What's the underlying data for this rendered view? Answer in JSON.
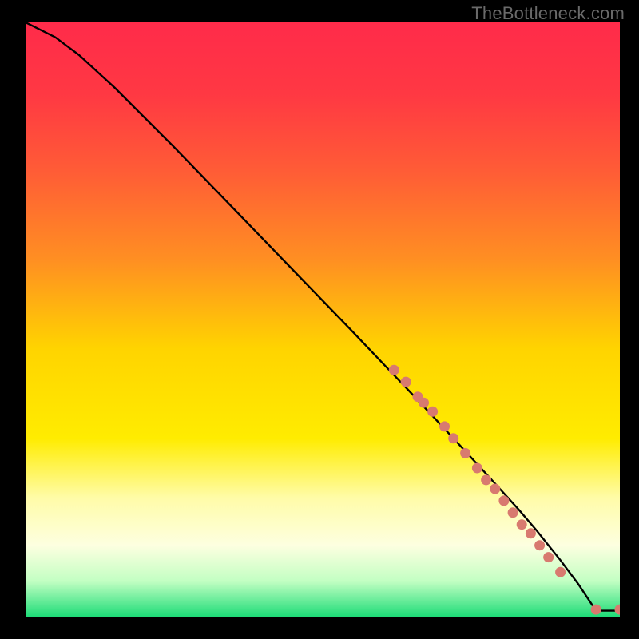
{
  "watermark": "TheBottleneck.com",
  "chart_data": {
    "type": "line",
    "title": "",
    "xlabel": "",
    "ylabel": "",
    "xlim": [
      0,
      100
    ],
    "ylim": [
      0,
      100
    ],
    "grid": false,
    "background_gradient": {
      "stops": [
        {
          "offset": 0,
          "color": "#ff2b4a"
        },
        {
          "offset": 12,
          "color": "#ff3843"
        },
        {
          "offset": 25,
          "color": "#ff5c36"
        },
        {
          "offset": 40,
          "color": "#ff8f22"
        },
        {
          "offset": 55,
          "color": "#ffd400"
        },
        {
          "offset": 70,
          "color": "#ffec00"
        },
        {
          "offset": 80,
          "color": "#fffca8"
        },
        {
          "offset": 88,
          "color": "#fdffe0"
        },
        {
          "offset": 94,
          "color": "#c3ffc3"
        },
        {
          "offset": 100,
          "color": "#1edc78"
        }
      ]
    },
    "series": [
      {
        "name": "curve",
        "type": "line",
        "color": "#000000",
        "x": [
          0,
          2,
          5,
          9,
          15,
          25,
          40,
          55,
          65,
          72,
          78,
          83,
          86,
          88,
          90,
          93,
          96,
          100
        ],
        "y": [
          100,
          99,
          97.5,
          94.5,
          89,
          79,
          63.5,
          48,
          37.5,
          30,
          23.5,
          18,
          14.5,
          12,
          9.5,
          5.5,
          1,
          1
        ]
      },
      {
        "name": "points",
        "type": "scatter",
        "color": "#d87a6f",
        "radius": 6.5,
        "points": [
          {
            "x": 62,
            "y": 41.5
          },
          {
            "x": 64,
            "y": 39.5
          },
          {
            "x": 66,
            "y": 37
          },
          {
            "x": 67,
            "y": 36
          },
          {
            "x": 68.5,
            "y": 34.5
          },
          {
            "x": 70.5,
            "y": 32
          },
          {
            "x": 72,
            "y": 30
          },
          {
            "x": 74,
            "y": 27.5
          },
          {
            "x": 76,
            "y": 25
          },
          {
            "x": 77.5,
            "y": 23
          },
          {
            "x": 79,
            "y": 21.5
          },
          {
            "x": 80.5,
            "y": 19.5
          },
          {
            "x": 82,
            "y": 17.5
          },
          {
            "x": 83.5,
            "y": 15.5
          },
          {
            "x": 85,
            "y": 14
          },
          {
            "x": 86.5,
            "y": 12
          },
          {
            "x": 88,
            "y": 10
          },
          {
            "x": 90,
            "y": 7.5
          },
          {
            "x": 96,
            "y": 1.2
          },
          {
            "x": 100,
            "y": 1.2
          }
        ]
      }
    ]
  }
}
